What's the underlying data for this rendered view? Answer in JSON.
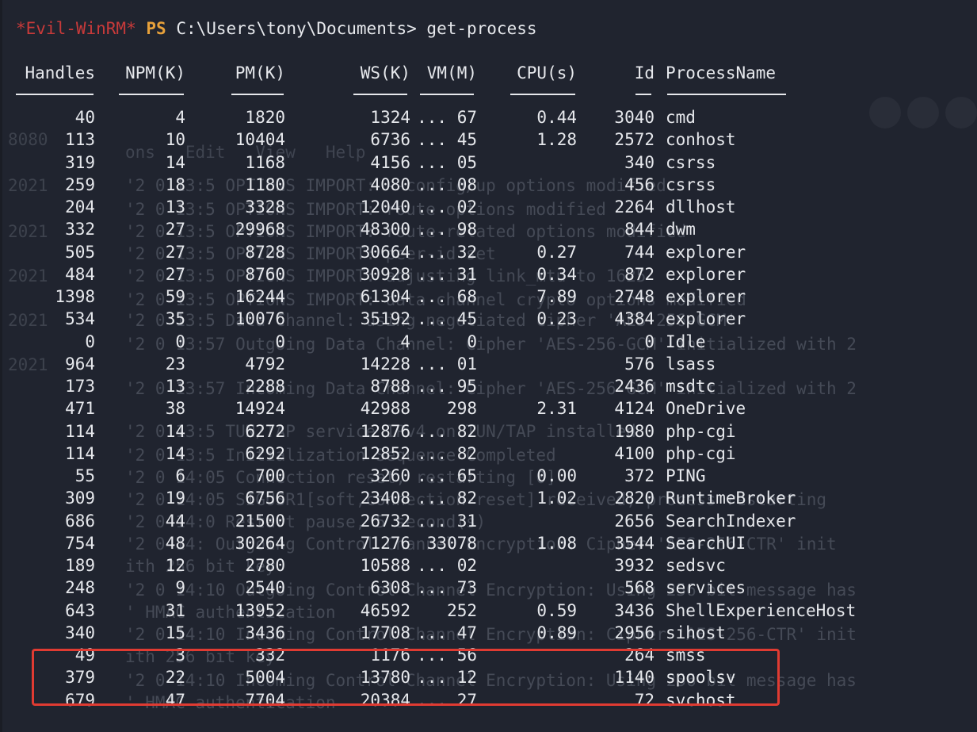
{
  "prompt": {
    "shell_name": "*Evil-WinRM*",
    "ps_label": "PS",
    "path": "C:\\Users\\tony\\Documents>",
    "command": "get-process"
  },
  "columns": [
    "Handles",
    "NPM(K)",
    "PM(K)",
    "WS(K)",
    "VM(M)",
    "CPU(s)",
    "Id",
    "ProcessName"
  ],
  "column_underlines": [
    "-------",
    "------",
    "-----",
    "-----",
    "-----",
    "------",
    "--",
    "-----------"
  ],
  "rows": [
    [
      "40",
      "4",
      "1820",
      "1324",
      "... 67",
      "0.44",
      "3040",
      "cmd"
    ],
    [
      "113",
      "10",
      "10404",
      "6736",
      "... 45",
      "1.28",
      "2572",
      "conhost"
    ],
    [
      "319",
      "14",
      "1168",
      "4156",
      "... 05",
      "",
      "340",
      "csrss"
    ],
    [
      "259",
      "18",
      "1180",
      "4080",
      "... 08",
      "",
      "456",
      "csrss"
    ],
    [
      "204",
      "13",
      "3328",
      "12040",
      "... 02",
      "",
      "2264",
      "dllhost"
    ],
    [
      "332",
      "27",
      "29968",
      "48300",
      "... 98",
      "",
      "844",
      "dwm"
    ],
    [
      "505",
      "27",
      "8728",
      "30664",
      "... 32",
      "0.27",
      "744",
      "explorer"
    ],
    [
      "484",
      "27",
      "8760",
      "30928",
      "... 31",
      "0.34",
      "872",
      "explorer"
    ],
    [
      "1398",
      "59",
      "16244",
      "61304",
      "... 68",
      "7.89",
      "2748",
      "explorer"
    ],
    [
      "534",
      "35",
      "10076",
      "35192",
      "... 45",
      "0.23",
      "4384",
      "explorer"
    ],
    [
      "0",
      "0",
      "0",
      "4",
      "0",
      "",
      "0",
      "Idle"
    ],
    [
      "964",
      "23",
      "4792",
      "14228",
      "... 01",
      "",
      "576",
      "lsass"
    ],
    [
      "173",
      "13",
      "2288",
      "8788",
      "... 95",
      "",
      "2436",
      "msdtc"
    ],
    [
      "471",
      "38",
      "14924",
      "42988",
      "298",
      "2.31",
      "4124",
      "OneDrive"
    ],
    [
      "114",
      "14",
      "6272",
      "12876",
      "... 82",
      "",
      "1980",
      "php-cgi"
    ],
    [
      "114",
      "14",
      "6292",
      "12852",
      "... 82",
      "",
      "4100",
      "php-cgi"
    ],
    [
      "55",
      "6",
      "700",
      "3260",
      "... 65",
      "0.00",
      "372",
      "PING"
    ],
    [
      "309",
      "19",
      "6756",
      "23408",
      "... 82",
      "1.02",
      "2820",
      "RuntimeBroker"
    ],
    [
      "686",
      "44",
      "21500",
      "26732",
      "... 31",
      "",
      "2656",
      "SearchIndexer"
    ],
    [
      "754",
      "48",
      "30264",
      "71276",
      "33078",
      "1.08",
      "3544",
      "SearchUI"
    ],
    [
      "189",
      "12",
      "2780",
      "10588",
      "... 02",
      "",
      "3932",
      "sedsvc"
    ],
    [
      "248",
      "9",
      "2540",
      "6308",
      "... 73",
      "",
      "568",
      "services"
    ],
    [
      "643",
      "31",
      "13952",
      "46592",
      "252",
      "0.59",
      "3436",
      "ShellExperienceHost"
    ],
    [
      "340",
      "15",
      "3436",
      "17708",
      "... 47",
      "0.89",
      "2956",
      "sihost"
    ],
    [
      "49",
      "3",
      "332",
      "1176",
      "... 56",
      "",
      "264",
      "smss"
    ],
    [
      "379",
      "22",
      "5004",
      "13780",
      "... 12",
      "",
      "1140",
      "spoolsv"
    ],
    [
      "679",
      "47",
      "7704",
      "20384",
      "... 27",
      "",
      "72",
      "svchost"
    ]
  ],
  "background_ghost": {
    "menu": "ons   Edit   View   Help",
    "stamps": [
      "8080",
      "2021",
      "2021",
      "2021",
      "2021",
      "2021"
    ],
    "lines": [
      "'2 0 13:5 OPTIONS IMPORT: --config/up options modified",
      "'2 0 13:5 OPTIONS IMPORT: route options modified",
      "'2 0 13:5 OPTIONS IMPORT: route-related options modified",
      "'2 0 13:5 OPTIONS IMPORT: peer-id set",
      "'2 0 13:5 OPTIONS IMPORT: adjusting link_mtu to 1625",
      "'2 0 13:5 OPTIONS IMPORT: data channel crypto options modified",
      "'2 0 13:5 Data Channel: using negotiated cipher 'AES-256-GCM'",
      "'2 0 13:57 Outgoing Data Channel: Cipher 'AES-256-GCM' initialized with 2",
      "'2 0 13:57 Incoming Data Channel: Cipher 'AES-256-GCM' initialized with 2",
      "'2 0 13:5 TUN/TAP service IPv4 on TUN/TAP installed",
      "'2 0 13:5 Initialization Sequence Completed",
      "'2 0 14:05 Connection reset, restarting [0]",
      "'2 0 14:05 SIGUSR1[soft,connection-reset] received, process restarting",
      "'2 0 14:0 Restart pause, 5 second(s)",
      "'2 0 14: Outgoing Control Channel Encryption: Cipher 'AES-256-CTR' init",
      "ith 256 bit key",
      "'2 0 14:10 Outgoing Control Channel Encryption: Using 256 bit message has",
      "' HMAC authentication",
      "'2 0 14:10 Incoming Control Channel Encryption: Cipher 'AES-256-CTR' init",
      "ith 256 bit key",
      "'2 0 14:10 Incoming Control Channel Encryption: Using 256 bit message has",
      "' HMAC authentication"
    ]
  },
  "colors": {
    "background": "#20242f",
    "text": "#e6e8ec",
    "shell_name": "#c83a3a",
    "ps_label": "#e8a13a",
    "highlight_box": "#e03b32",
    "ghost_text": "#454a56"
  }
}
